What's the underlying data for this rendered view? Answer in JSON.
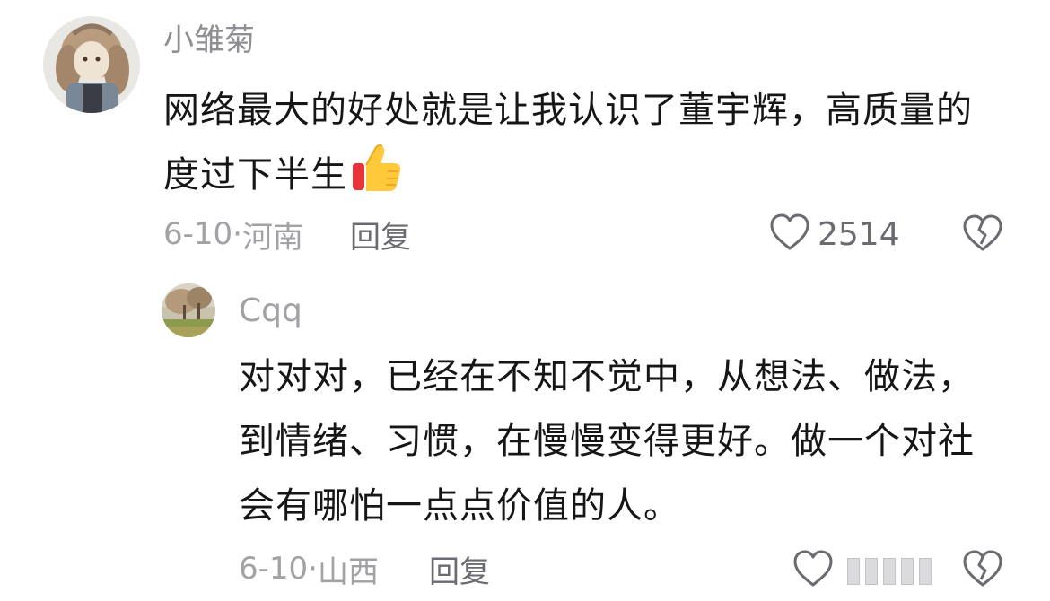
{
  "comment": {
    "username": "小雏菊",
    "text": "网络最大的好处就是让我认识了董宇辉，高质量的度过下半生",
    "emoji": "thumbs-up-icon",
    "date": "6-10",
    "separator": "·",
    "location": "河南",
    "reply_label": "回复",
    "like_count": "2514"
  },
  "reply": {
    "username": "Cqq",
    "text": "对对对，已经在不知不觉中，从想法、做法，到情绪、习惯，在慢慢变得更好。做一个对社会有哪怕一点点价值的人。",
    "date": "6-10",
    "separator": "·",
    "location": "山西",
    "reply_label": "回复"
  },
  "colors": {
    "text_primary": "#161616",
    "text_secondary": "#a1a1a6",
    "icon_gray": "#6a6a70"
  }
}
